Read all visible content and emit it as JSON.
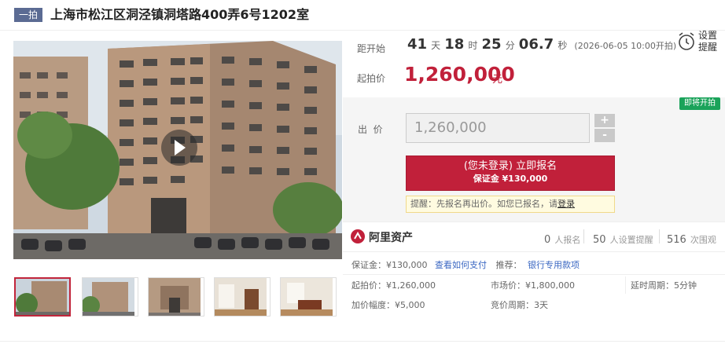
{
  "header": {
    "tag": "一拍",
    "title": "上海市松江区洞泾镇洞塔路400弄6号1202室"
  },
  "countdown": {
    "label": "距开始",
    "days": "41",
    "days_unit": "天",
    "hours": "18",
    "hours_unit": "时",
    "minutes": "25",
    "minutes_unit": "分",
    "seconds": "06.7",
    "seconds_unit": "秒",
    "start_time": "(2026-06-05 10:00开拍)"
  },
  "reminder_setting": {
    "line1": "设置",
    "line2": "提醒"
  },
  "start_price": {
    "label": "起拍价",
    "value": "1,260,000",
    "unit": "元"
  },
  "bid": {
    "badge": "即将开拍",
    "label": "出  价",
    "input_value": "1,260,000",
    "plus": "+",
    "minus": "-",
    "signup_line1": "(您未登录) 立即报名",
    "signup_line2": "保证金 ¥130,000",
    "reminder_text": "提醒：先报名再出价。如您已报名，请",
    "reminder_link": "登录"
  },
  "platform": {
    "name": "阿里资产",
    "stats": [
      {
        "num": "0",
        "label": "人报名"
      },
      {
        "num": "50",
        "label": "人设置提醒"
      },
      {
        "num": "516",
        "label": "次围观"
      }
    ]
  },
  "info": {
    "deposit": "保证金：¥130,000",
    "deposit_link": "查看如何支付",
    "recommend_label": "推荐：",
    "recommend_link": "银行专用款项",
    "start_price": "起拍价：¥1,260,000",
    "market_price": "市场价：¥1,800,000",
    "delay_period": "延时周期：5分钟",
    "increment": "加价幅度：¥5,000",
    "bid_period": "竞价周期：3天"
  },
  "colors": {
    "accent_red": "#c1203a",
    "tag_blue": "#5b6b93",
    "link_blue": "#3a67c2",
    "badge_green": "#1aa35a"
  }
}
